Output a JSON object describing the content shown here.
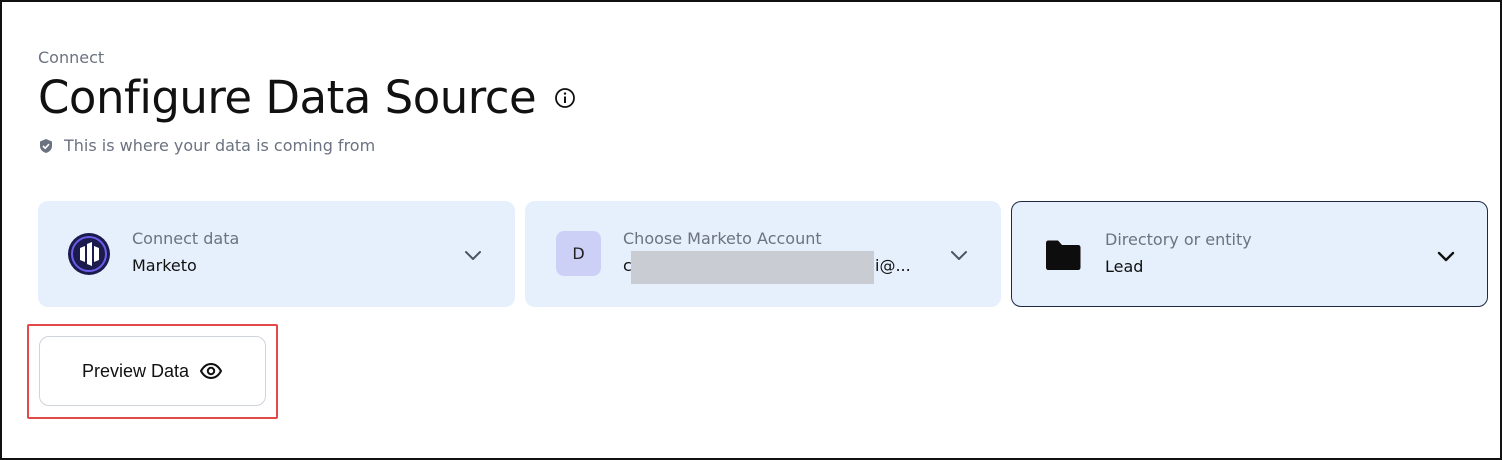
{
  "header": {
    "breadcrumb": "Connect",
    "title": "Configure Data Source",
    "subtitle": "This is where your data is coming from"
  },
  "cards": [
    {
      "label": "Connect data",
      "value": "Marketo",
      "icon": "marketo-logo-icon"
    },
    {
      "label": "Choose Marketo Account",
      "value_prefix": "c",
      "value_suffix": "i@...",
      "avatar": "D",
      "icon": "avatar-d"
    },
    {
      "label": "Directory or entity",
      "value": "Lead",
      "icon": "folder-icon"
    }
  ],
  "actions": {
    "preview_label": "Preview Data"
  },
  "colors": {
    "card_bg": "#e6effc",
    "highlight": "#e24a4a",
    "marketo": "#1b1b4d"
  }
}
